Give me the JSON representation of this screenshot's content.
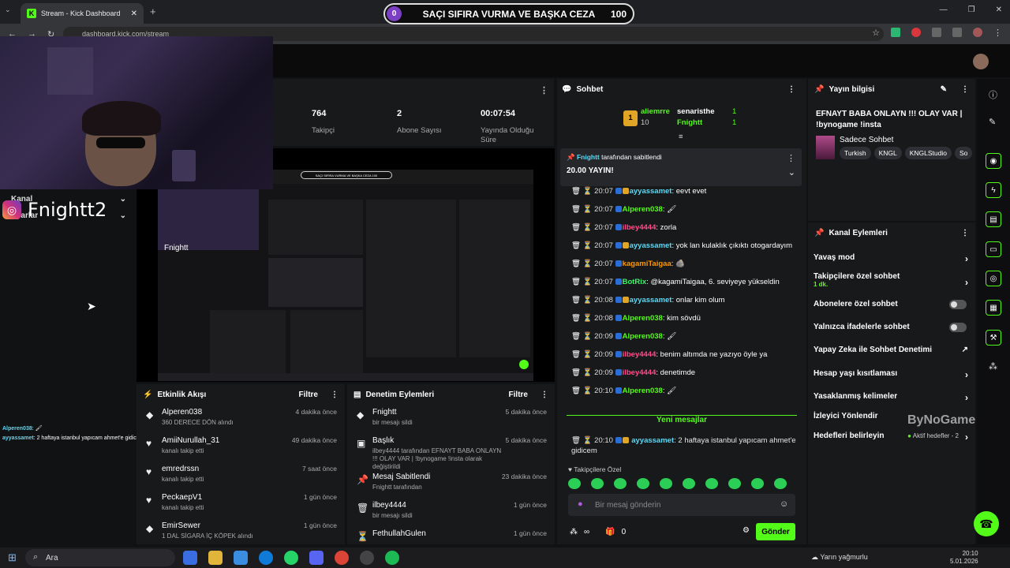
{
  "browser": {
    "tab_title": "Stream - Kick Dashboard",
    "tab_favicon": "K",
    "url": "dashboard.kick.com/stream",
    "new_tab": "+"
  },
  "banner": {
    "left": "0",
    "text": "SAÇI SIFIRA VURMA VE BAŞKA CEZA",
    "right": "100"
  },
  "overlay": {
    "instagram_name": "Fnightt2",
    "kanal": "Kanal",
    "ayarlar": "Ayarlar",
    "chat_lines": [
      {
        "user": "Alperen038",
        "text": ": 🖌"
      },
      {
        "user": "ayyassamet",
        "text": ": 2 haftaya istanbul yapıcam ahmet'e gidicem"
      }
    ]
  },
  "stats": [
    {
      "value": "764",
      "label": "Takipçi"
    },
    {
      "value": "2",
      "label": "Abone Sayısı"
    },
    {
      "value": "00:07:54",
      "label": "Yayında Olduğu Süre"
    }
  ],
  "preview": {
    "pill": "SAÇI SIFIRA VURMA VE BAŞKA CEZA 100",
    "name": "Fnightt"
  },
  "activity": {
    "title": "Etkinlik Akışı",
    "filter": "Filtre",
    "items": [
      {
        "name": "Alperen038",
        "sub": "360 DERECE DÖN alındı",
        "time": "4 dakika önce",
        "green": true
      },
      {
        "name": "AmiiNurullah_31",
        "sub": "kanalı takip etti",
        "time": "49 dakika önce",
        "green": false
      },
      {
        "name": "emredrssn",
        "sub": "kanalı takip etti",
        "time": "7 saat önce",
        "green": false
      },
      {
        "name": "PeckaepV1",
        "sub": "kanalı takip etti",
        "time": "1 gün önce",
        "green": false
      },
      {
        "name": "EmirSewer",
        "sub": "1 DAL SİGARA İÇ KÖPEK alındı",
        "time": "1 gün önce",
        "green": true
      }
    ]
  },
  "moderation": {
    "title": "Denetim Eylemleri",
    "filter": "Filtre",
    "items": [
      {
        "name": "Fnightt",
        "sub": "bir mesajı sildi",
        "time": "5 dakika önce"
      },
      {
        "name": "Başlık",
        "sub": "ilbey4444 tarafından EFNAYT BABA ONLAYN !!! OLAY VAR | !bynogame !insta olarak değiştirildi",
        "time": "5 dakika önce"
      },
      {
        "name": "Mesaj Sabitlendi",
        "sub": "Fnightt tarafından",
        "time": "23 dakika önce"
      },
      {
        "name": "ilbey4444",
        "sub": "bir mesajı sildi",
        "time": "1 gün önce"
      },
      {
        "name": "FethullahGulen",
        "sub": "",
        "time": "1 gün önce"
      }
    ]
  },
  "chat": {
    "title": "Sohbet",
    "leaders": {
      "first_name": "aliemrre",
      "first_count": "10",
      "second_name": "senaristhe",
      "second_count": "1",
      "third_name": "Fnightt",
      "third_count": "1"
    },
    "pinned_by": "Fnightt",
    "pinned_suffix": "tarafından sabitlendi",
    "pinned_text": "20.00 YAYIN!",
    "messages": [
      {
        "time": "20:07",
        "user": "ayyassamet",
        "ucls": "u1",
        "text": ": eevt evet"
      },
      {
        "time": "20:07",
        "user": "Alperen038",
        "ucls": "u2",
        "text": ": 🖌"
      },
      {
        "time": "20:07",
        "user": "ilbey4444",
        "ucls": "u4",
        "text": ": zorla"
      },
      {
        "time": "20:07",
        "user": "ayyassamet",
        "ucls": "u1",
        "text": ": yok lan kulaklık çıkıktı otogardayım"
      },
      {
        "time": "20:07",
        "user": "kagamiTaigaa",
        "ucls": "u3",
        "text": ": 🪨"
      },
      {
        "time": "20:07",
        "user": "BotRix",
        "ucls": "u5",
        "text": ": @kagamiTaigaa, 6. seviyeye yükseldin"
      },
      {
        "time": "20:08",
        "user": "ayyassamet",
        "ucls": "u1",
        "text": ": onlar kim olum"
      },
      {
        "time": "20:08",
        "user": "Alperen038",
        "ucls": "u2",
        "text": ": kim sövdü"
      },
      {
        "time": "20:09",
        "user": "Alperen038",
        "ucls": "u2",
        "text": ": 🖌"
      },
      {
        "time": "20:09",
        "user": "ilbey4444",
        "ucls": "u4",
        "text": ": benim altımda ne yazıyo öyle ya"
      },
      {
        "time": "20:09",
        "user": "ilbey4444",
        "ucls": "u4",
        "text": ": denetimde"
      },
      {
        "time": "20:10",
        "user": "Alperen038",
        "ucls": "u2",
        "text": ": 🖌"
      }
    ],
    "new_messages": "Yeni mesajlar",
    "last_message": {
      "time": "20:10",
      "user": "ayyassamet",
      "text": ": 2 haftaya istanbul yapıcam ahmet'e gidicem"
    },
    "followers_only": "Takipçilere Özel",
    "input_placeholder": "Bir mesaj gönderin",
    "points": "∞",
    "gifts": "0",
    "send": "Gönder"
  },
  "info": {
    "title": "Yayın bilgisi",
    "stream_title": "EFNAYT BABA ONLAYN !!! OLAY VAR | !bynogame !insta",
    "category": "Sadece Sohbet",
    "tags": [
      "Turkish",
      "KNGL",
      "KNGLStudio",
      "So"
    ]
  },
  "channel_actions": {
    "title": "Kanal Eylemleri",
    "slow_mode": "Yavaş mod",
    "followers_chat": "Takipçilere özel sohbet",
    "followers_chat_sub": "1 dk.",
    "subs_chat": "Abonelere özel sohbet",
    "emote_chat": "Yalnızca ifadelerle sohbet",
    "ai_mod": "Yapay Zeka ile Sohbet Denetimi",
    "age_limits": "Hesap yaşı kısıtlaması",
    "banned_words": "Yasaklanmış kelimeler",
    "redirect": "İzleyici Yönlendir",
    "goals": "Hedefleri belirleyin",
    "goals_sub": "Aktif hedefler - 2"
  },
  "watermark": "ByNoGame",
  "taskbar": {
    "search": "Ara",
    "weather": "Yarın yağmurlu",
    "time": "20:10",
    "date": "5.01.2026"
  },
  "colors": {
    "accent": "#53fc18",
    "panel": "#18191b",
    "background": "#111213"
  }
}
